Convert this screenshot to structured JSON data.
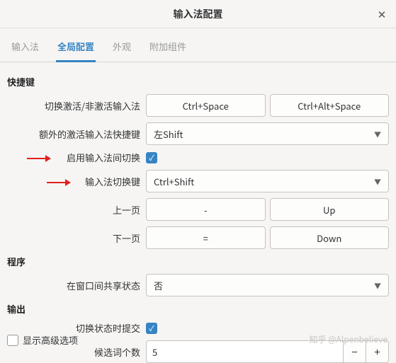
{
  "window": {
    "title": "输入法配置"
  },
  "tabs": {
    "t0": "输入法",
    "t1": "全局配置",
    "t2": "外观",
    "t3": "附加组件"
  },
  "sections": {
    "hotkeys": "快捷键",
    "program": "程序",
    "output": "输出"
  },
  "labels": {
    "toggleActivate": "切换激活/非激活输入法",
    "extraActivate": "额外的激活输入法快捷键",
    "enableIMSwitch": "启用输入法间切换",
    "imSwitchKey": "输入法切换键",
    "prevPage": "上一页",
    "nextPage": "下一页",
    "shareState": "在窗口间共享状态",
    "commitOnSwitch": "切换状态时提交",
    "candidateCount": "候选词个数",
    "showAdvanced": "显示高级选项"
  },
  "values": {
    "hotkey1": "Ctrl+Space",
    "hotkey2": "Ctrl+Alt+Space",
    "extraActivate": "左Shift",
    "enableIMSwitch": true,
    "imSwitchKey": "Ctrl+Shift",
    "prevPage1": "-",
    "prevPage2": "Up",
    "nextPage1": "=",
    "nextPage2": "Down",
    "shareState": "否",
    "commitOnSwitch": true,
    "candidateCount": "5",
    "showAdvanced": false
  },
  "watermark": "知乎 @Alpenbelieve"
}
